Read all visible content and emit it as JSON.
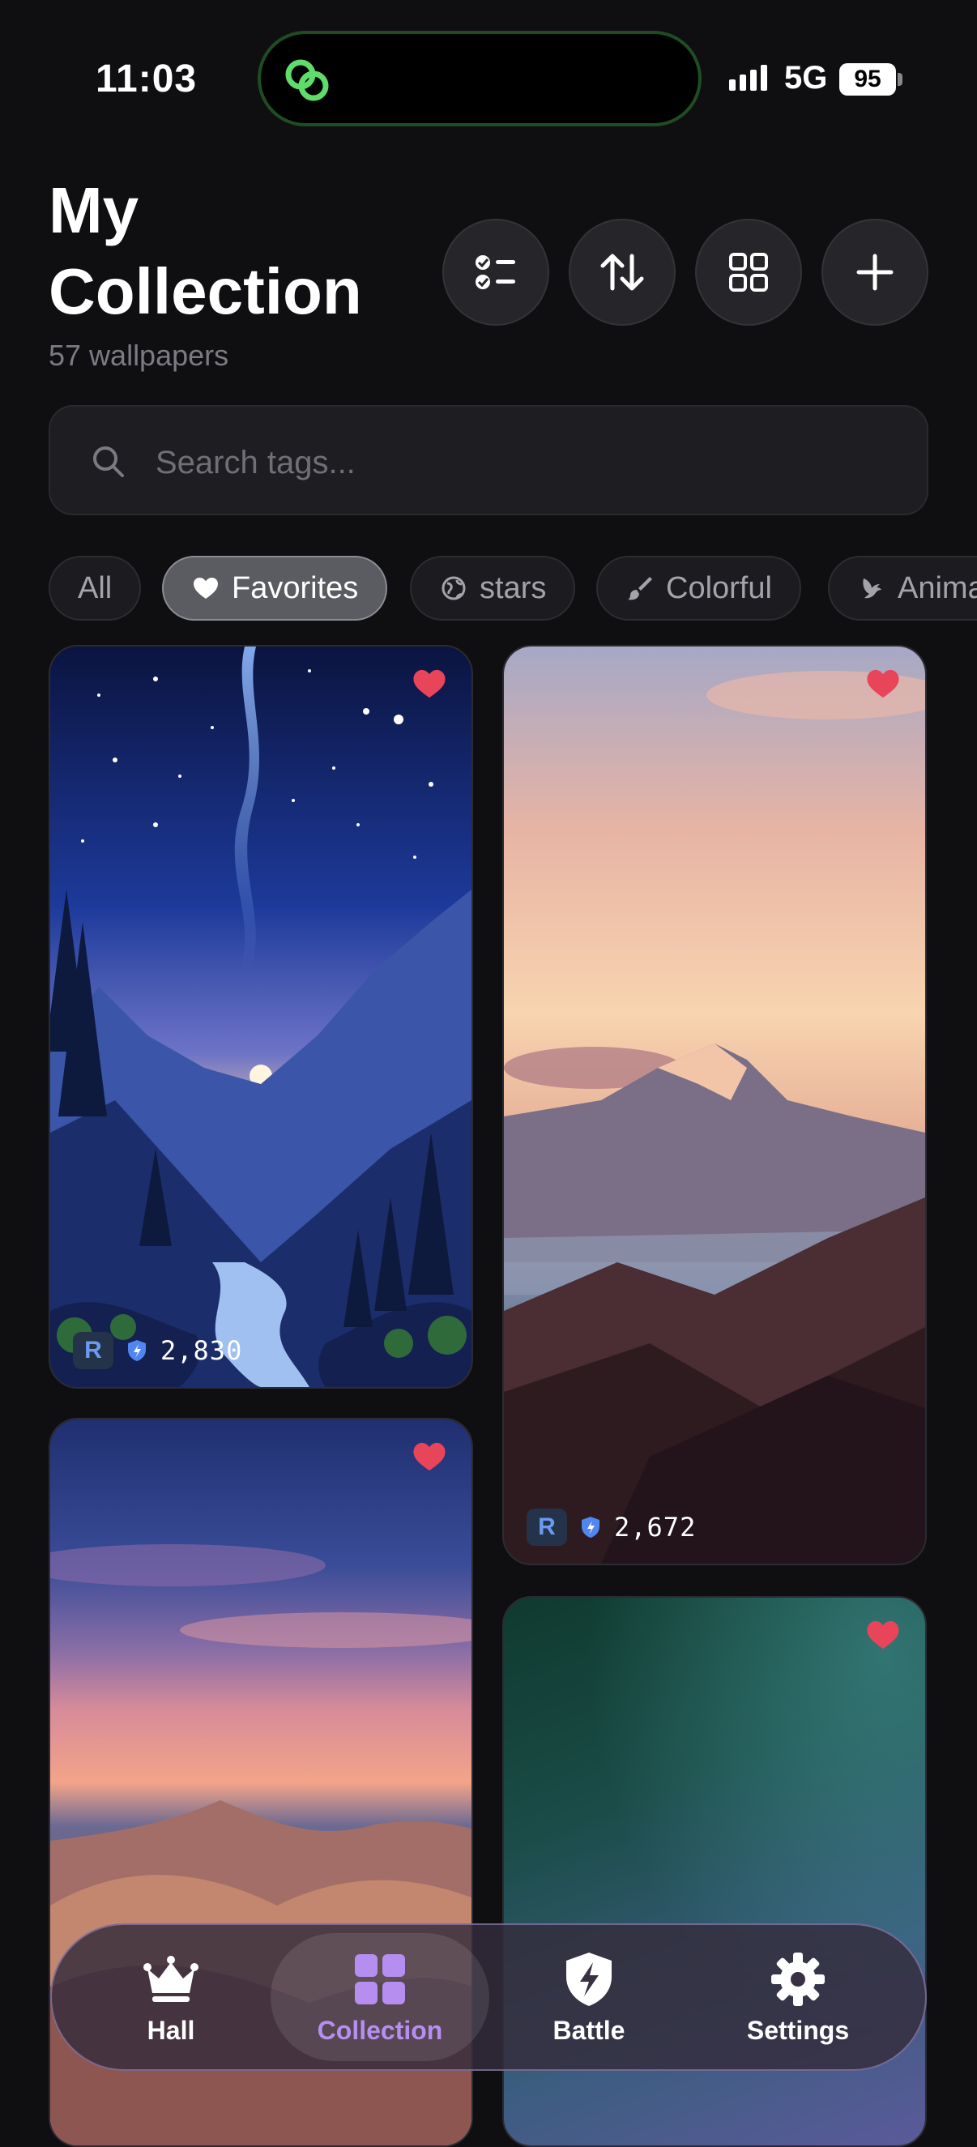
{
  "status_bar": {
    "time": "11:03",
    "network": "5G",
    "battery": "95"
  },
  "header": {
    "title": "My Collection",
    "subtitle": "57 wallpapers"
  },
  "toolbar": {
    "icons": [
      "checklist-icon",
      "sort-icon",
      "grid-view-icon",
      "plus-icon"
    ]
  },
  "search": {
    "placeholder": "Search tags..."
  },
  "filters": {
    "chips": [
      {
        "label": "All",
        "icon": null,
        "active": false
      },
      {
        "label": "Favorites",
        "icon": "heart-icon",
        "active": true
      },
      {
        "label": "stars",
        "icon": "globe-icon",
        "active": false
      },
      {
        "label": "Colorful",
        "icon": "brush-icon",
        "active": false
      },
      {
        "label": "Anima",
        "icon": "bird-icon",
        "active": false
      }
    ]
  },
  "wallpapers": [
    {
      "rank": "R",
      "score": "2,830",
      "favorite": true,
      "scene": "starry-night-river-valley"
    },
    {
      "rank": "R",
      "score": "2,672",
      "favorite": true,
      "scene": "sunset-mountain-peak"
    },
    {
      "favorite": true,
      "scene": "desert-dunes-twilight"
    },
    {
      "favorite": true,
      "scene": "teal-purple-gradient"
    }
  ],
  "nav": {
    "items": [
      {
        "label": "Hall",
        "icon": "crown-icon",
        "active": false
      },
      {
        "label": "Collection",
        "icon": "grid-icon",
        "active": true
      },
      {
        "label": "Battle",
        "icon": "shield-bolt-icon",
        "active": false
      },
      {
        "label": "Settings",
        "icon": "gear-icon",
        "active": false
      }
    ]
  },
  "colors": {
    "background": "#0f0f12",
    "accent": "#b68ef0",
    "favorite": "#e8445a",
    "rank_badge": "#6b9bf0"
  }
}
